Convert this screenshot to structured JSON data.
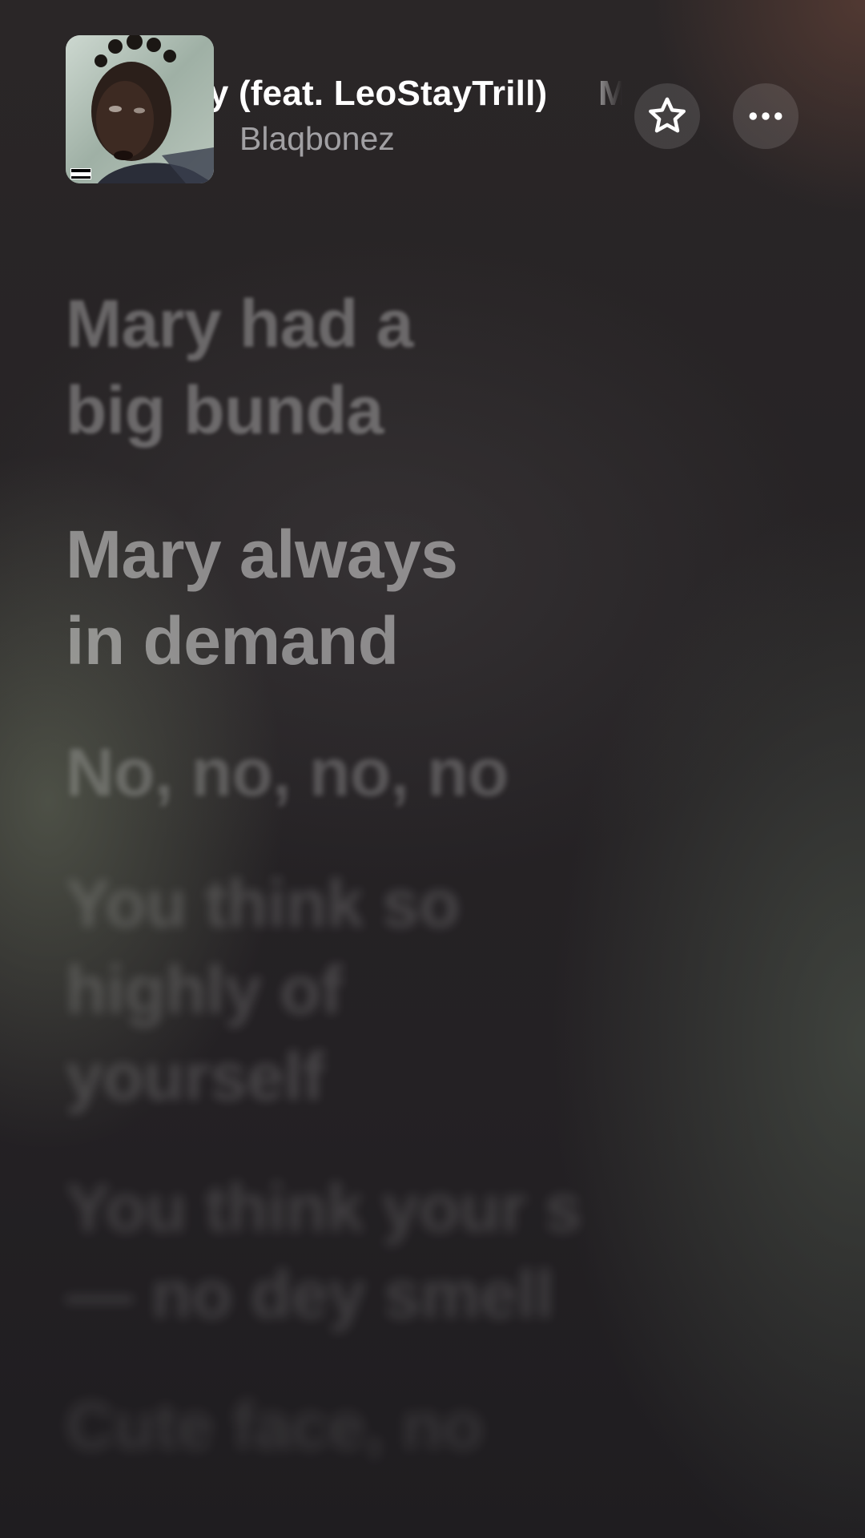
{
  "now_playing": {
    "title": "Mary (feat. LeoStayTrill)",
    "title_repeat": "Mary (feat. LeoStayTrill)",
    "artist": "Blaqbonez",
    "artwork_icon": "album-artwork"
  },
  "controls": {
    "favorite_icon": "star-icon",
    "more_icon": "ellipsis-icon"
  },
  "lyrics": [
    "Mary had a\nbig bunda",
    "Mary always\nin demand",
    "No, no, no, no",
    "You think so\nhighly of\nyourself",
    "You think your s\n— no dey smell",
    "Cute face, no"
  ],
  "colors": {
    "text_primary": "#ffffff",
    "text_secondary": "#a9a7ab",
    "button_bg": "#3a3638"
  }
}
